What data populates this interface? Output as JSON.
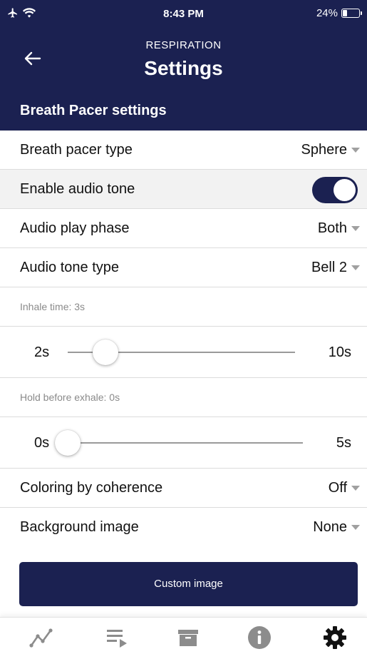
{
  "status_bar": {
    "time": "8:43 PM",
    "battery_text": "24%",
    "battery_level": 0.24,
    "icons": [
      "airplane-icon",
      "wifi-icon",
      "battery-icon"
    ]
  },
  "header": {
    "subtitle": "RESPIRATION",
    "title": "Settings",
    "back_icon": "arrow-left-icon"
  },
  "section": {
    "title": "Breath Pacer settings"
  },
  "settings": {
    "pacer_type": {
      "label": "Breath pacer type",
      "value": "Sphere"
    },
    "audio_tone": {
      "label": "Enable audio tone",
      "enabled": true
    },
    "audio_phase": {
      "label": "Audio play phase",
      "value": "Both"
    },
    "tone_type": {
      "label": "Audio tone type",
      "value": "Bell 2"
    },
    "inhale": {
      "caption": "Inhale time: 3s",
      "min_label": "2s",
      "max_label": "10s",
      "min": 2,
      "max": 10,
      "value": 3
    },
    "hold": {
      "caption": "Hold before exhale: 0s",
      "min_label": "0s",
      "max_label": "5s",
      "min": 0,
      "max": 5,
      "value": 0
    },
    "coloring": {
      "label": "Coloring by coherence",
      "value": "Off"
    },
    "background": {
      "label": "Background image",
      "value": "None"
    }
  },
  "custom_image_button": "Custom image",
  "tabbar": {
    "tabs": [
      "chart-icon",
      "playlist-icon",
      "archive-icon",
      "info-icon",
      "gear-icon"
    ],
    "active": "gear-icon"
  },
  "colors": {
    "primary": "#1b2151",
    "icon_gray": "#8c8c8c",
    "caret": "#a0a0a0"
  }
}
